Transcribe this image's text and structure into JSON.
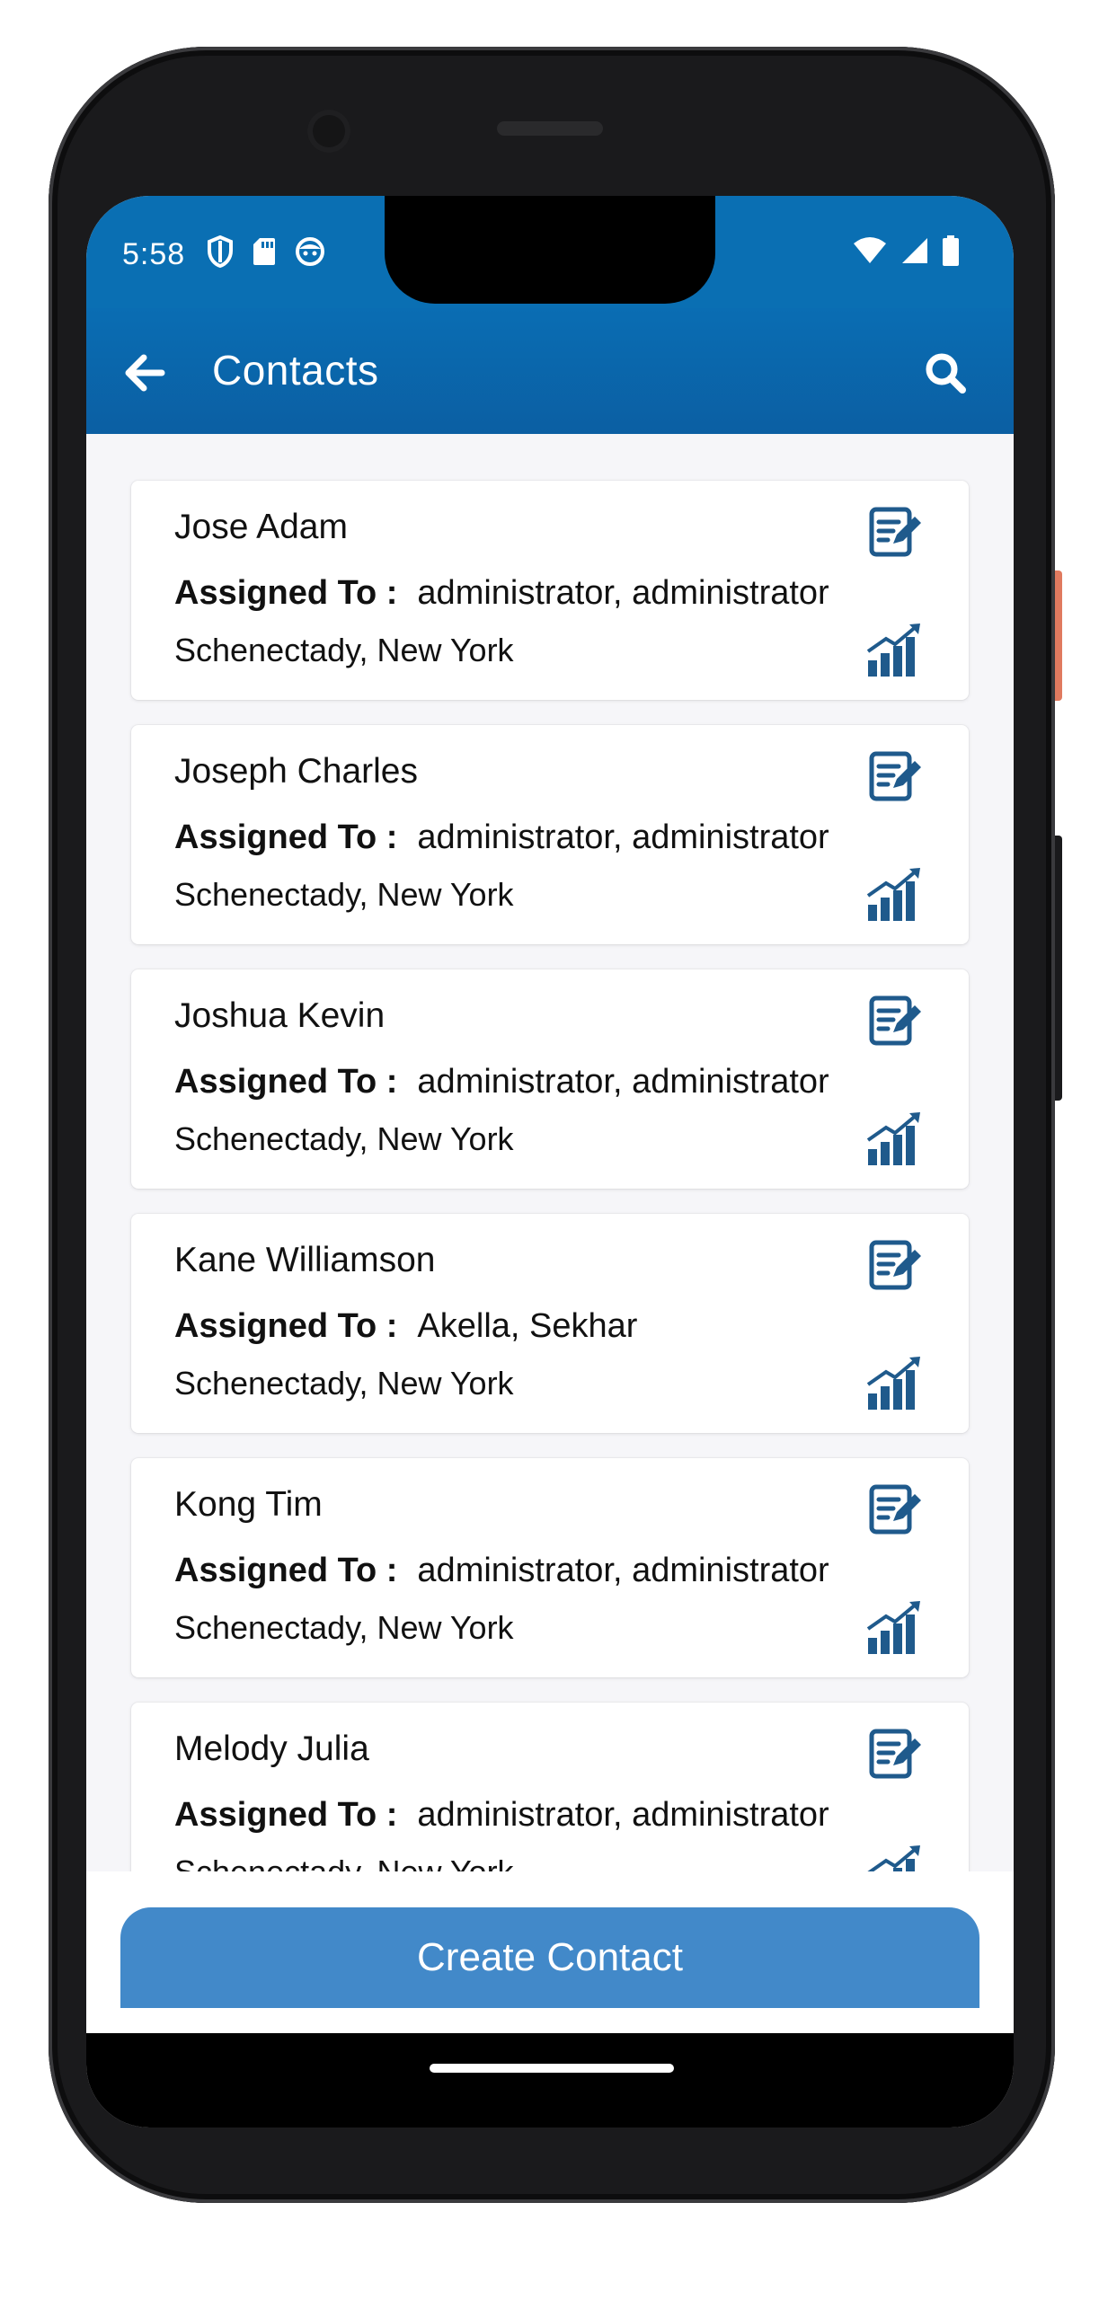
{
  "status_bar": {
    "time": "5:58",
    "left_icons": [
      "shield-icon",
      "sd-card-icon",
      "face-icon"
    ],
    "right_icons": [
      "wifi-icon",
      "signal-icon",
      "battery-icon"
    ]
  },
  "app_bar": {
    "title": "Contacts",
    "back_icon": "arrow-left-icon",
    "search_icon": "search-icon"
  },
  "contacts": [
    {
      "name": "Jose Adam",
      "assigned_label": "Assigned To :",
      "assigned_to": "administrator, administrator",
      "location": "Schenectady, New York"
    },
    {
      "name": "Joseph Charles",
      "assigned_label": "Assigned To :",
      "assigned_to": "administrator, administrator",
      "location": "Schenectady, New York"
    },
    {
      "name": "Joshua Kevin",
      "assigned_label": "Assigned To :",
      "assigned_to": "administrator, administrator",
      "location": "Schenectady, New York"
    },
    {
      "name": "Kane Williamson",
      "assigned_label": "Assigned To :",
      "assigned_to": "Akella, Sekhar",
      "location": "Schenectady, New York"
    },
    {
      "name": "Kong Tim",
      "assigned_label": "Assigned To :",
      "assigned_to": "administrator, administrator",
      "location": "Schenectady, New York"
    },
    {
      "name": "Melody Julia",
      "assigned_label": "Assigned To :",
      "assigned_to": "administrator, administrator",
      "location": "Schenectady, New York"
    }
  ],
  "card_icons": {
    "edit": "edit-note-icon",
    "chart": "growth-chart-icon"
  },
  "footer": {
    "create_label": "Create Contact"
  },
  "colors": {
    "app_bar": "#0b66ad",
    "accent_button": "#4289c9",
    "icon": "#1f5a8c",
    "background": "#f6f6f9"
  }
}
